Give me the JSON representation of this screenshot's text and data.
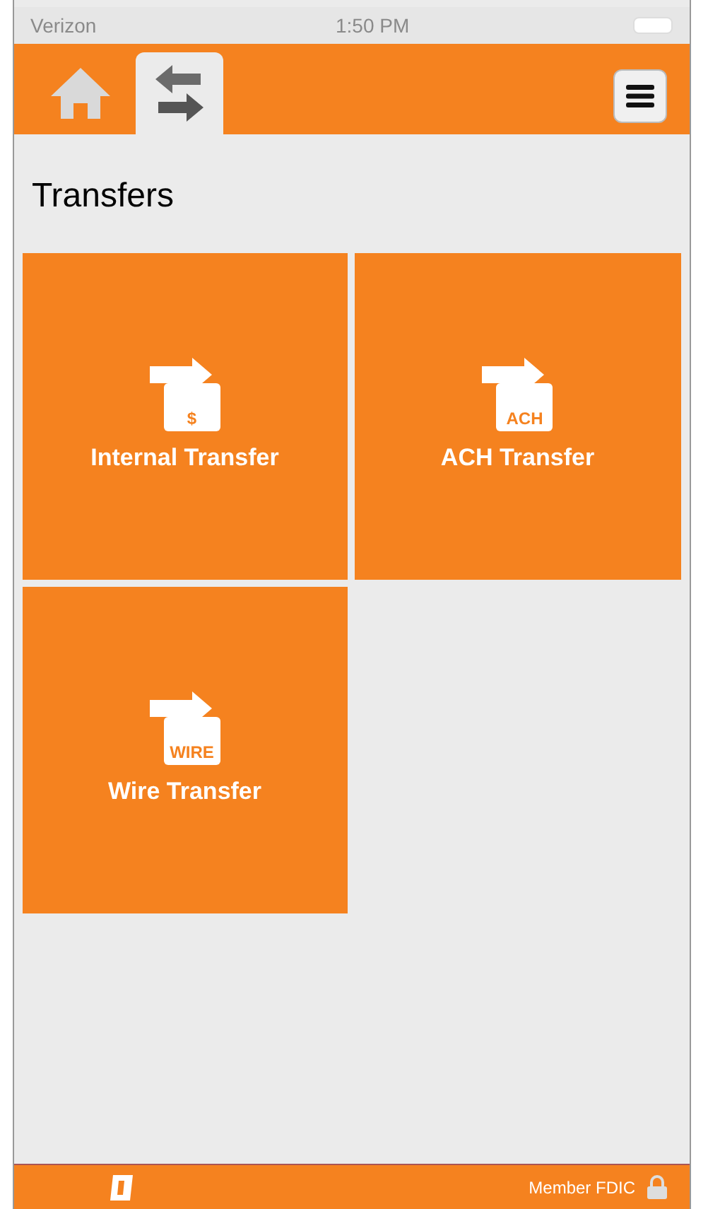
{
  "status_bar": {
    "carrier": "Verizon",
    "time": "1:50 PM"
  },
  "tabs": [
    {
      "kind": "home",
      "selected": false
    },
    {
      "kind": "transfers",
      "selected": true
    }
  ],
  "page_title": "Transfers",
  "tiles": [
    {
      "label": "Internal Transfer",
      "badge": "$"
    },
    {
      "label": "ACH Transfer",
      "badge": "ACH"
    },
    {
      "label": "Wire Transfer",
      "badge": "WIRE"
    }
  ],
  "footer": {
    "text": "Member FDIC"
  }
}
